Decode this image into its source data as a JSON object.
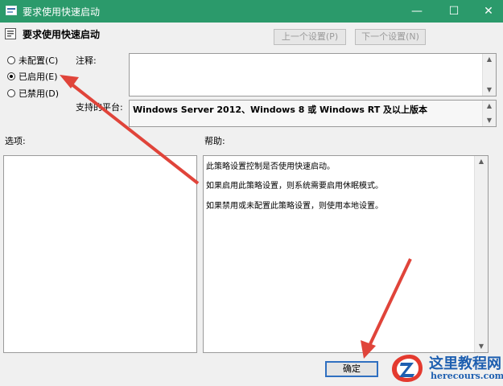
{
  "window": {
    "title": "要求使用快速启动",
    "minimize_glyph": "—",
    "maximize_glyph": "☐",
    "close_glyph": "✕"
  },
  "header": {
    "title": "要求使用快速启动",
    "prev_setting_label": "上一个设置(P)",
    "next_setting_label": "下一个设置(N)"
  },
  "options": {
    "not_configured": "未配置(C)",
    "enabled": "已启用(E)",
    "disabled": "已禁用(D)",
    "selected": "enabled"
  },
  "comment": {
    "label": "注释:",
    "value": ""
  },
  "platform": {
    "label": "支持的平台:",
    "value": "Windows Server 2012、Windows 8 或 Windows RT 及以上版本"
  },
  "options_panel": {
    "label": "选项:"
  },
  "help": {
    "label": "帮助:",
    "lines": [
      "此策略设置控制是否使用快速启动。",
      "如果启用此策略设置，则系统需要启用休眠模式。",
      "如果禁用或未配置此策略设置，则使用本地设置。"
    ]
  },
  "buttons": {
    "ok": "确定"
  },
  "watermark": {
    "brand_cn": "这里教程网",
    "brand_url": "herecours.com"
  },
  "icons": {
    "title_icon": "policy-icon",
    "header_icon": "policy-settings-icon",
    "watermark_logo": "z-logo-icon"
  },
  "colors": {
    "titlebar": "#2b9a6b",
    "annotation_arrow": "#e0443a",
    "ok_border": "#2f6fc0",
    "watermark": "#1e5fb0"
  }
}
